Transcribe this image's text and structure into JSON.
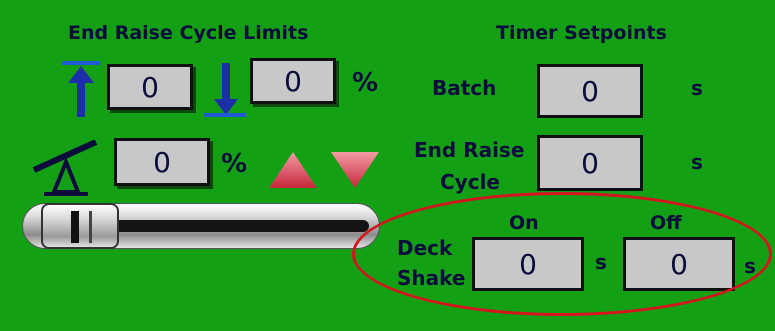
{
  "limits": {
    "title": "End Raise Cycle Limits",
    "raise_value": "0",
    "lower_value": "0",
    "percent_unit": "%",
    "tilt_value": "0",
    "tilt_unit": "%"
  },
  "timers": {
    "title": "Timer Setpoints",
    "batch_label": "Batch",
    "batch_value": "0",
    "batch_unit": "s",
    "end_raise_label_line1": "End Raise",
    "end_raise_label_line2": "Cycle",
    "end_raise_value": "0",
    "end_raise_unit": "s",
    "deck_shake_label_line1": "Deck",
    "deck_shake_label_line2": "Shake",
    "on_label": "On",
    "off_label": "Off",
    "on_value": "0",
    "on_unit": "s",
    "off_value": "0",
    "off_unit": "s"
  },
  "icons": {
    "raise": "up-arrow-icon",
    "lower": "down-arrow-icon",
    "tilt": "seesaw-tilt-icon",
    "increase": "triangle-up-icon",
    "decrease": "triangle-down-icon"
  },
  "colors": {
    "background": "#14a014",
    "text": "#0b0b3c",
    "field": "#c8c8c8",
    "highlight": "#d4141e",
    "arrow": "#e05a6e"
  },
  "slider": {
    "position_percent": 0
  }
}
